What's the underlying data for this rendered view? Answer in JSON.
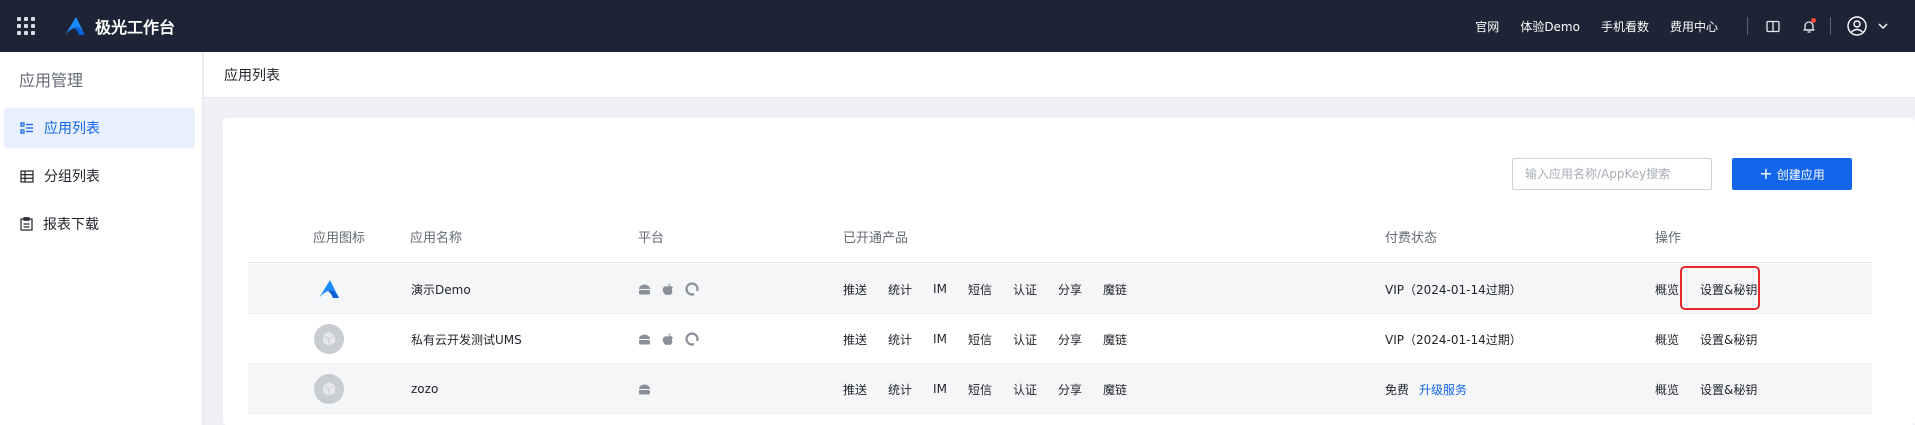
{
  "topbar": {
    "brand_name": "极光工作台",
    "links": [
      "官网",
      "体验Demo",
      "手机看数",
      "费用中心"
    ]
  },
  "sidebar": {
    "title": "应用管理",
    "items": [
      {
        "label": "应用列表",
        "icon": "list-icon",
        "active": true
      },
      {
        "label": "分组列表",
        "icon": "table-icon",
        "active": false
      },
      {
        "label": "报表下载",
        "icon": "report-icon",
        "active": false
      }
    ]
  },
  "page": {
    "title": "应用列表"
  },
  "toolbar": {
    "search_placeholder": "输入应用名称/AppKey搜索",
    "create_label": "创建应用"
  },
  "table": {
    "headers": [
      "应用图标",
      "应用名称",
      "平台",
      "已开通产品",
      "付费状态",
      "操作"
    ],
    "rows": [
      {
        "name": "演示Demo",
        "icon": "jiguang-logo",
        "platforms": [
          "android",
          "apple",
          "harmony"
        ],
        "products": [
          "推送",
          "统计",
          "IM",
          "短信",
          "认证",
          "分享",
          "魔链"
        ],
        "pay_status": "VIP（2024-01-14过期）",
        "pay_link": "",
        "actions": [
          "概览",
          "设置&秘钥"
        ]
      },
      {
        "name": "私有云开发测试UMS",
        "icon": "default-cube",
        "platforms": [
          "android",
          "apple",
          "harmony"
        ],
        "products": [
          "推送",
          "统计",
          "IM",
          "短信",
          "认证",
          "分享",
          "魔链"
        ],
        "pay_status": "VIP（2024-01-14过期）",
        "pay_link": "",
        "actions": [
          "概览",
          "设置&秘钥"
        ]
      },
      {
        "name": "zozo",
        "icon": "default-cube",
        "platforms": [
          "android"
        ],
        "products": [
          "推送",
          "统计",
          "IM",
          "短信",
          "认证",
          "分享",
          "魔链"
        ],
        "pay_status": "免费",
        "pay_link": "升级服务",
        "actions": [
          "概览",
          "设置&秘钥"
        ]
      }
    ]
  },
  "colors": {
    "topbar_bg": "#1c2435",
    "accent": "#1366ec",
    "highlight": "#e8262c"
  }
}
